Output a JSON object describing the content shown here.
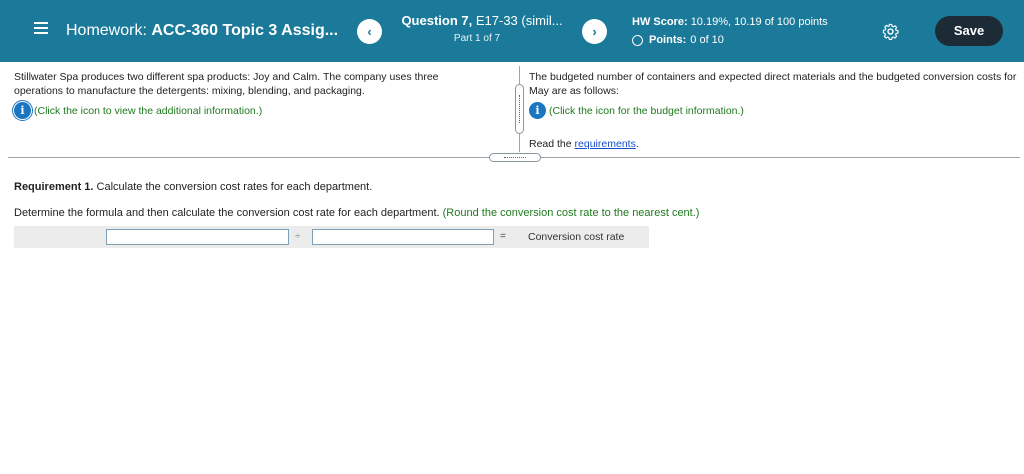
{
  "header": {
    "menu_icon": "hamburger-menu-icon",
    "homework_prefix": "Homework:",
    "homework_title": "ACC-360 Topic 3 Assig...",
    "prev_label": "‹",
    "next_label": "›",
    "question_prefix": "Question 7,",
    "question_title": "E17-33 (simil...",
    "part": "Part 1 of 7",
    "score_label": "HW Score:",
    "score_value": "10.19%, 10.19 of 100 points",
    "points_label": "Points:",
    "points_value": "0 of 10",
    "settings_icon": "gear-icon",
    "save_label": "Save",
    "bg_color": "#1b7a9a"
  },
  "left_panel": {
    "text": "Stillwater Spa produces two different spa products: Joy and Calm. The company uses three operations to manufacture the detergents: mixing, blending, and packaging.",
    "info_text": "(Click the icon to view the additional information.)"
  },
  "right_panel": {
    "text": "The budgeted number of containers and expected direct materials and the budgeted conversion costs for May are as follows:",
    "info_text": "(Click the icon for the budget information.)",
    "read_prefix": "Read the",
    "requirements_link": "requirements",
    "read_suffix": "."
  },
  "requirement": {
    "label": "Requirement 1.",
    "text": "Calculate the conversion cost rates for each department.",
    "instruction": "Determine the formula and then calculate the conversion cost rate for each department.",
    "hint": "(Round the conversion cost rate to the nearest cent.)"
  },
  "formula": {
    "input_a_value": "",
    "input_b_value": "",
    "divide_symbol": "÷",
    "equals_symbol": "=",
    "result_label": "Conversion cost rate"
  },
  "colors": {
    "accent": "#1b7a9a",
    "save_button": "#1d2b36",
    "hint_green": "#1e7a1e",
    "info_blue": "#1a76c1",
    "link_blue": "#1a4fcc"
  }
}
